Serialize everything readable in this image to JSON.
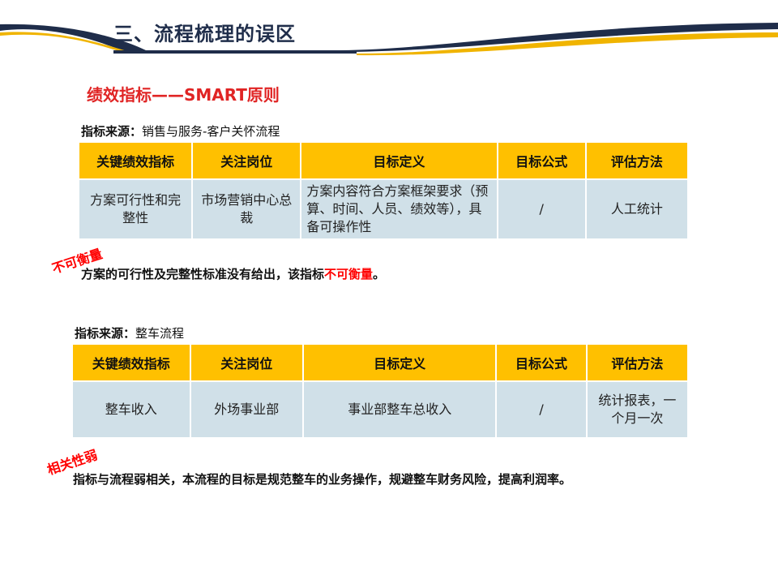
{
  "header": {
    "title": "三、流程梳理的误区"
  },
  "subtitle": "绩效指标——SMART原则",
  "table1": {
    "source_label": "指标来源：",
    "source_value": "销售与服务-客户关怀流程",
    "headers": [
      "关键绩效指标",
      "关注岗位",
      "目标定义",
      "目标公式",
      "评估方法"
    ],
    "row": [
      "方案可行性和完整性",
      "市场营销中心总裁",
      "方案内容符合方案框架要求（预算、时间、人员、绩效等），具备可操作性",
      "/",
      "人工统计"
    ],
    "stamp": "不可衡量",
    "note_prefix": "方案的可行性及完整性标准没有给出，该指标",
    "note_highlight": "不可衡量",
    "note_suffix": "。"
  },
  "table2": {
    "source_label": "指标来源：",
    "source_value": "整车流程",
    "headers": [
      "关键绩效指标",
      "关注岗位",
      "目标定义",
      "目标公式",
      "评估方法"
    ],
    "row": [
      "整车收入",
      "外场事业部",
      "事业部整车总收入",
      "/",
      "统计报表，一个月一次"
    ],
    "stamp": "相关性弱",
    "note": "指标与流程弱相关，本流程的目标是规范整车的业务操作，规避整车财务风险，提高利润率。"
  },
  "colors": {
    "header_fill": "#ffc000",
    "cell_fill": "#d0e0e8",
    "accent_red": "#ff0000",
    "title_navy": "#1f2d4a"
  }
}
